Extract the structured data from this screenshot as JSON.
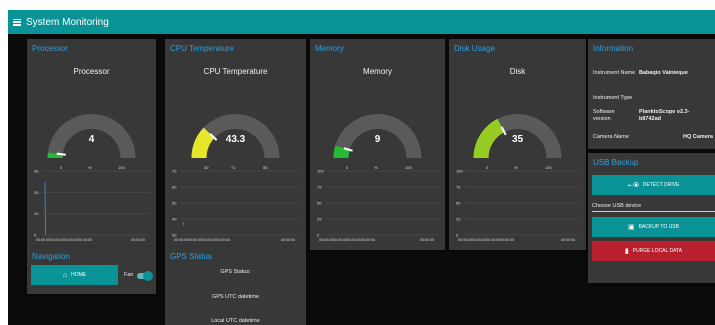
{
  "header": {
    "title": "System Monitoring"
  },
  "gauges": [
    {
      "card_title": "Processor",
      "label": "Processor",
      "value": "4",
      "min": "0",
      "max": "100",
      "unit": "%",
      "fraction": 0.04,
      "color": "#22bb33"
    },
    {
      "card_title": "CPU Temperature",
      "label": "CPU Temperature",
      "value": "43.3",
      "min": "30",
      "max": "85",
      "unit": "°C",
      "fraction": 0.242,
      "color": "#e6e62a"
    },
    {
      "card_title": "Memory",
      "label": "Memory",
      "value": "9",
      "min": "0",
      "max": "100",
      "unit": "%",
      "fraction": 0.09,
      "color": "#22bb33"
    },
    {
      "card_title": "Disk Usage",
      "label": "Disk",
      "value": "35",
      "min": "0",
      "max": "100",
      "unit": "%",
      "fraction": 0.35,
      "color": "#99cc22"
    }
  ],
  "gauge_track_color": "#5a5a5a",
  "chart_data": [
    {
      "type": "line",
      "yticks": [
        "30",
        "20",
        "10",
        "0"
      ],
      "ylim": [
        0,
        30
      ],
      "xticks": [
        "00:00:00",
        "00:00:00",
        "00:00:00",
        "00:00:00",
        "00:00:00"
      ],
      "series": [
        {
          "values": [
            25,
            0
          ]
        }
      ],
      "color": "#2f7fd8"
    },
    {
      "type": "line",
      "yticks": [
        "70",
        "60",
        "50",
        "40",
        "30"
      ],
      "ylim": [
        30,
        70
      ],
      "xticks": [
        "00:00:00",
        "00:00:00",
        "00:00:00",
        "00:00:00",
        "00:00:00"
      ],
      "series": [
        {
          "values": [
            38,
            36
          ]
        }
      ],
      "color": "#2f7fd8"
    },
    {
      "type": "line",
      "yticks": [
        "100",
        "75",
        "50",
        "25",
        "0"
      ],
      "ylim": [
        0,
        100
      ],
      "xticks": [
        "00:00:00",
        "00:00:00",
        "00:00:00",
        "00:00:00",
        "00:00:00"
      ],
      "series": [
        {
          "values": []
        }
      ],
      "color": "#2f7fd8"
    },
    {
      "type": "line",
      "yticks": [
        "100",
        "75",
        "50",
        "25",
        "0"
      ],
      "ylim": [
        0,
        100
      ],
      "xticks": [
        "00:00:00",
        "00:00:00",
        "00:00:00",
        "00:00:00",
        "00:00:00"
      ],
      "series": [
        {
          "values": []
        }
      ],
      "color": "#2f7fd8"
    }
  ],
  "information": {
    "title": "Information",
    "rows": [
      {
        "key": "Instrument Name",
        "value": "Babaqio Vainieque"
      },
      {
        "key": "Instrument Type",
        "value": ""
      },
      {
        "key": "Software version",
        "value": "PlanktoScope v2.3-b8742ad"
      },
      {
        "key": "Camera Name",
        "value": "HQ Camera"
      }
    ]
  },
  "usb": {
    "title": "USB Backup",
    "detect_label": "DETECT DRIVE",
    "select_placeholder": "Choose USB device",
    "backup_label": "BACKUP TO USB",
    "purge_label": "PURGE LOCAL DATA"
  },
  "navigation": {
    "title": "Navigation",
    "home_label": "HOME",
    "fan_label": "Fan",
    "fan_on": true
  },
  "gps": {
    "title": "GPS Status",
    "rows": [
      "GPS Status:",
      "GPS UTC datetime",
      "Local UTC datetime"
    ]
  },
  "colors": {
    "accent": "#0a9396",
    "title_blue": "#2f9fd8",
    "danger": "#b8202e",
    "card": "#383838"
  }
}
